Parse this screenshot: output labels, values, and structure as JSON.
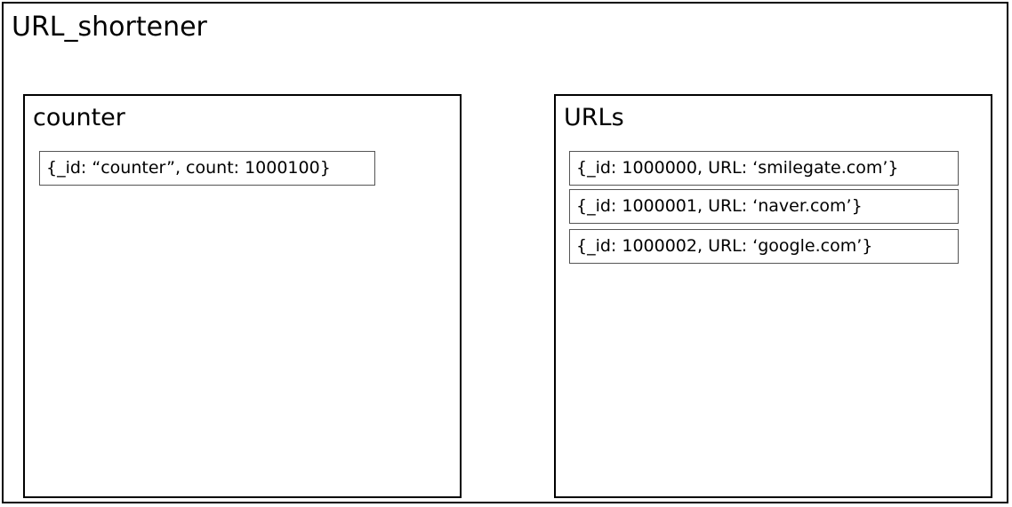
{
  "database": {
    "name": "URL_shortener"
  },
  "collections": {
    "counter": {
      "name": "counter",
      "documents": [
        "{_id: “counter”, count: 1000100}"
      ]
    },
    "urls": {
      "name": "URLs",
      "documents": [
        "{_id: 1000000, URL: ‘smilegate.com’}",
        "{_id: 1000001, URL: ‘naver.com’}",
        "{_id: 1000002, URL: ‘google.com’}"
      ]
    }
  }
}
